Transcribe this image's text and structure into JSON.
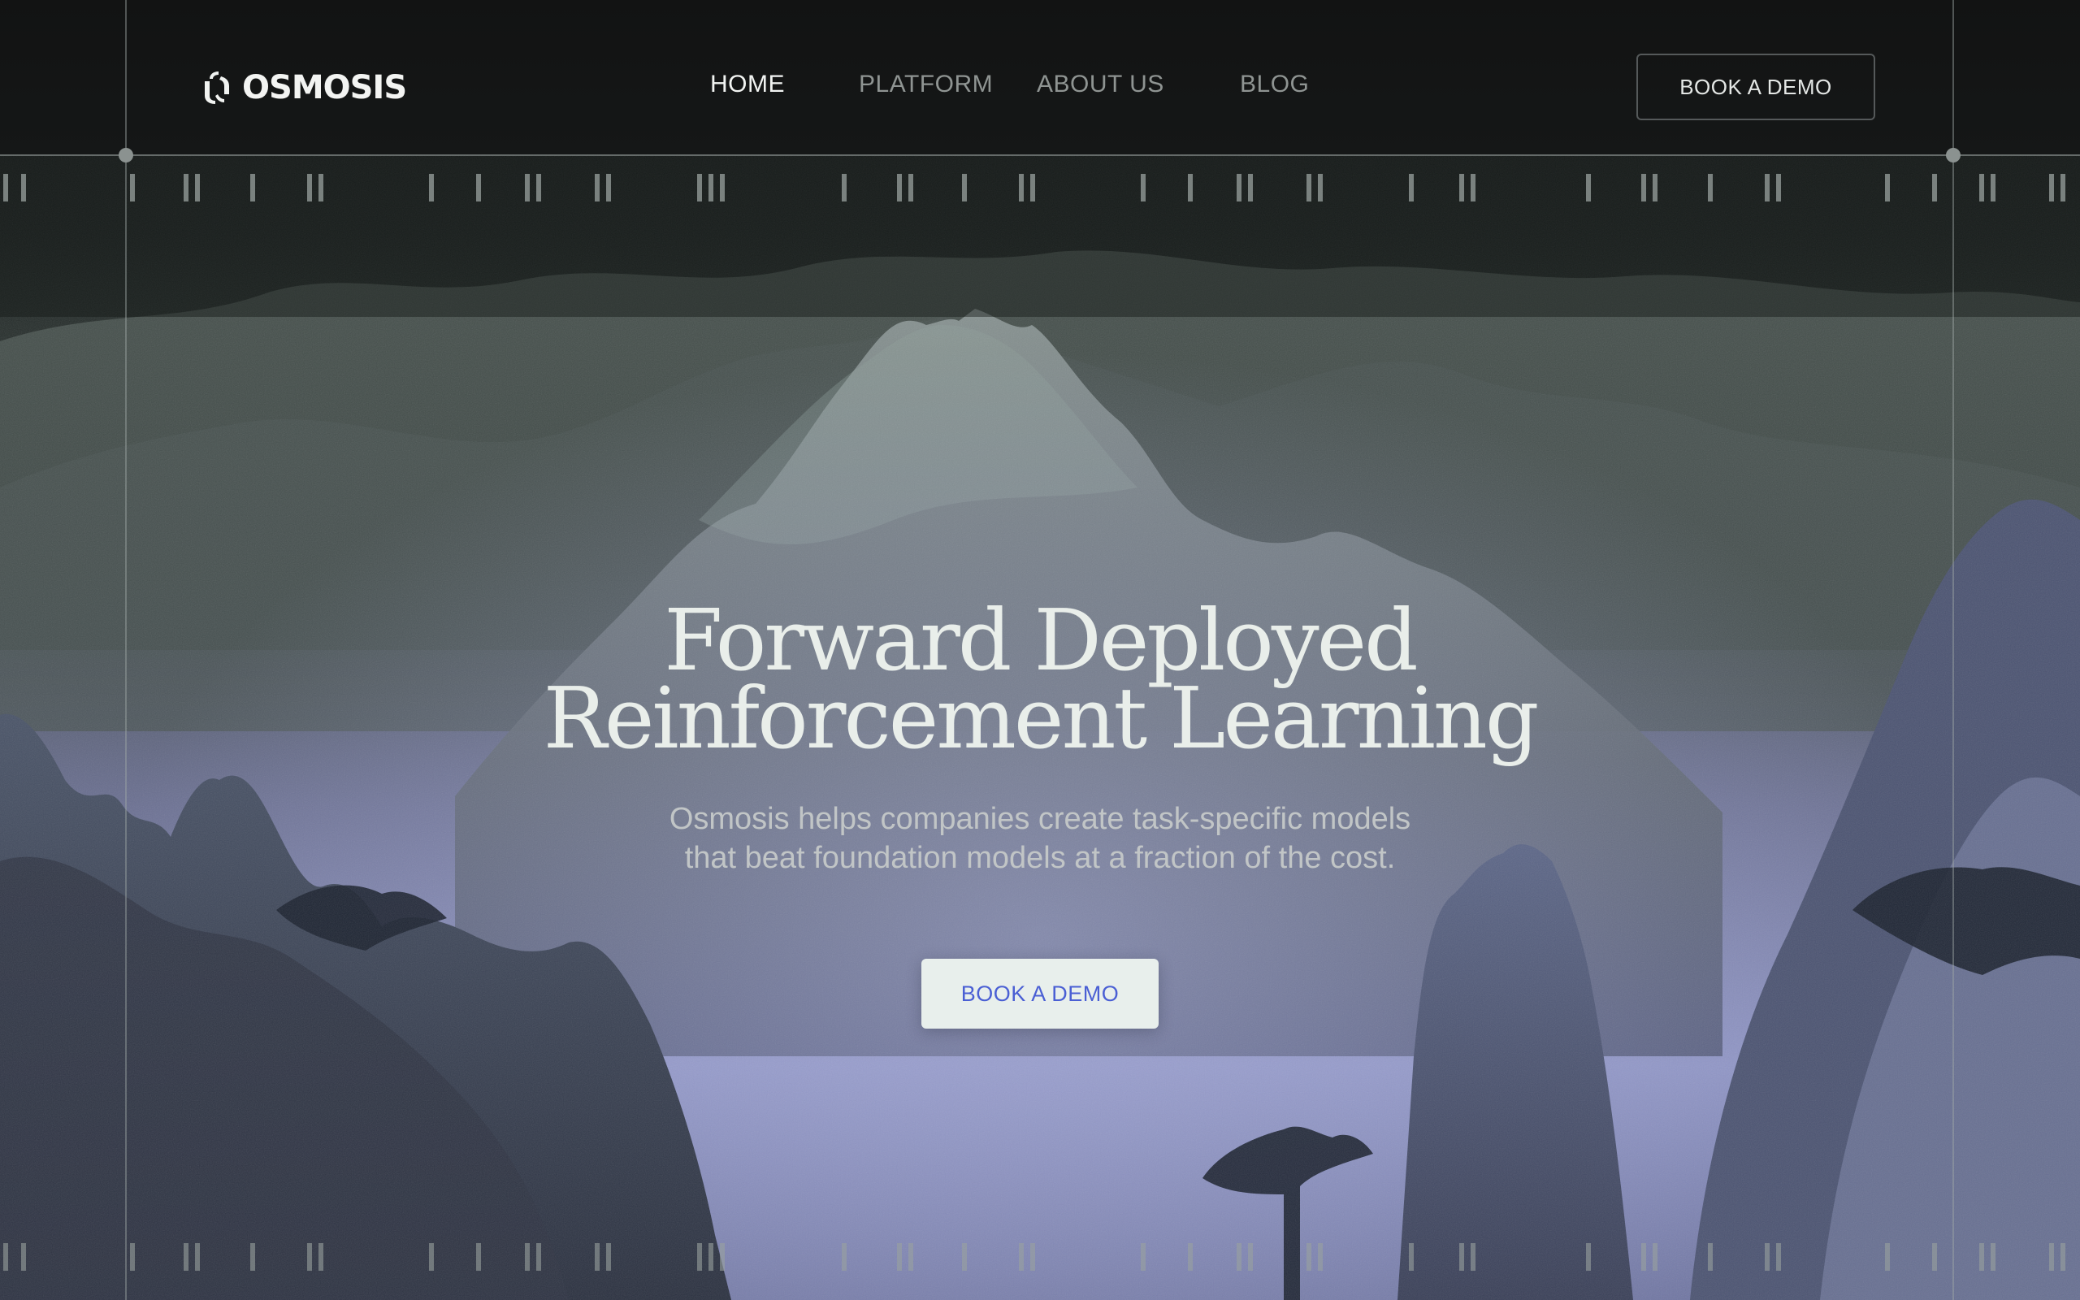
{
  "brand": {
    "name": "OSMOSIS",
    "logo_icon": "osmosis-logo-icon"
  },
  "nav": {
    "links": [
      {
        "label": "HOME",
        "active": true
      },
      {
        "label": "PLATFORM",
        "active": false
      },
      {
        "label": "ABOUT US",
        "active": false
      },
      {
        "label": "BLOG",
        "active": false
      }
    ],
    "cta_label": "BOOK A DEMO"
  },
  "hero": {
    "title_lines": [
      "Forward Deployed",
      "Reinforcement Learning"
    ],
    "subtitle_lines": [
      "Osmosis helps companies create task-specific models",
      "that beat foundation models at a fraction of the cost."
    ],
    "cta_label": "BOOK A DEMO"
  },
  "colors": {
    "background": "#121313",
    "text_primary": "#e9eeea",
    "text_muted": "#8f9492",
    "cta_bg": "#e8efec",
    "cta_text": "#4a5fd4",
    "sky_lavender": "#8d93c4"
  }
}
